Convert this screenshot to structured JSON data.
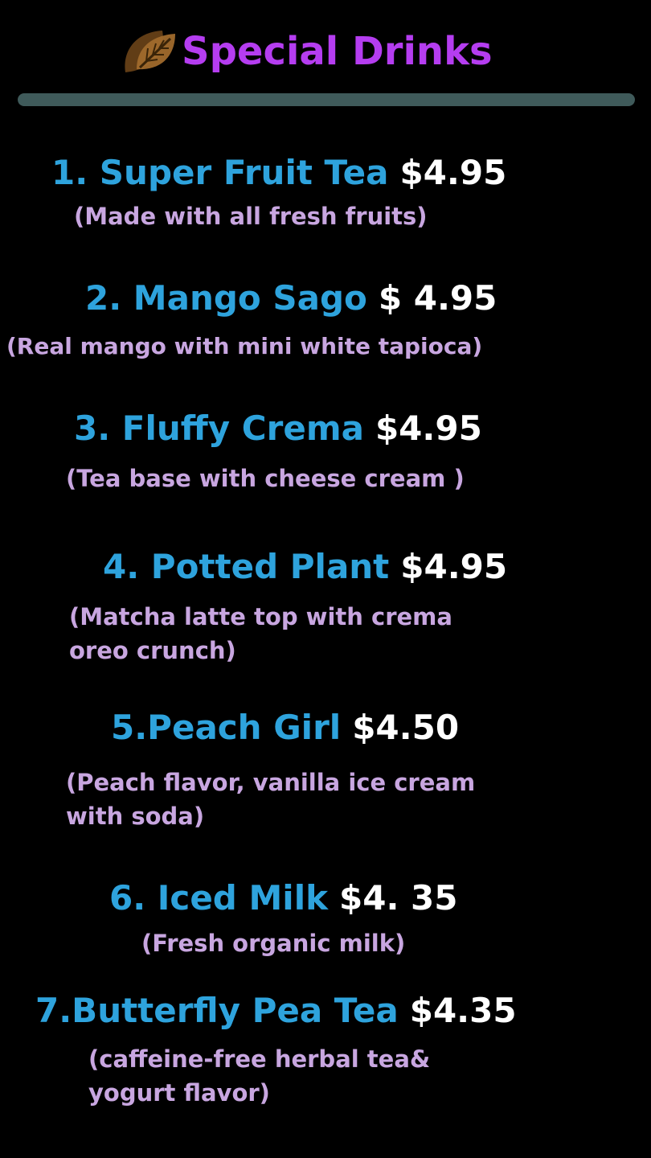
{
  "colors": {
    "background": "#000000",
    "title": "#B53DF0",
    "item_name": "#2EA3DD",
    "price": "#FFFFFF",
    "description": "#C8A6E0",
    "divider": "#3F5A5A",
    "logo": "#8A5A22"
  },
  "header": {
    "title": "Special Drinks",
    "logo_icon": "leaf-logo-icon"
  },
  "items": [
    {
      "name": "1. Super Fruit Tea",
      "price": "$4.95",
      "desc_lines": [
        "(Made with all fresh fruits)"
      ]
    },
    {
      "name": "2. Mango Sago",
      "price": "$ 4.95",
      "desc_lines": [
        "(Real mango with mini white tapioca)"
      ]
    },
    {
      "name": "3. Fluffy Crema",
      "price": "$4.95",
      "desc_lines": [
        "(Tea base with cheese cream )"
      ]
    },
    {
      "name": "4. Potted Plant",
      "price": "$4.95",
      "desc_lines": [
        "(Matcha latte top with crema",
        " oreo crunch)"
      ]
    },
    {
      "name": "5.Peach Girl",
      "price": "$4.50",
      "desc_lines": [
        "(Peach flavor, vanilla ice cream",
        "with soda)"
      ]
    },
    {
      "name": "6. Iced Milk",
      "price": "$4. 35",
      "desc_lines": [
        "(Fresh organic milk)"
      ]
    },
    {
      "name": "7.Butterfly Pea Tea",
      "price": "$4.35",
      "desc_lines": [
        "(caffeine-free herbal tea&",
        "yogurt flavor)"
      ]
    }
  ]
}
